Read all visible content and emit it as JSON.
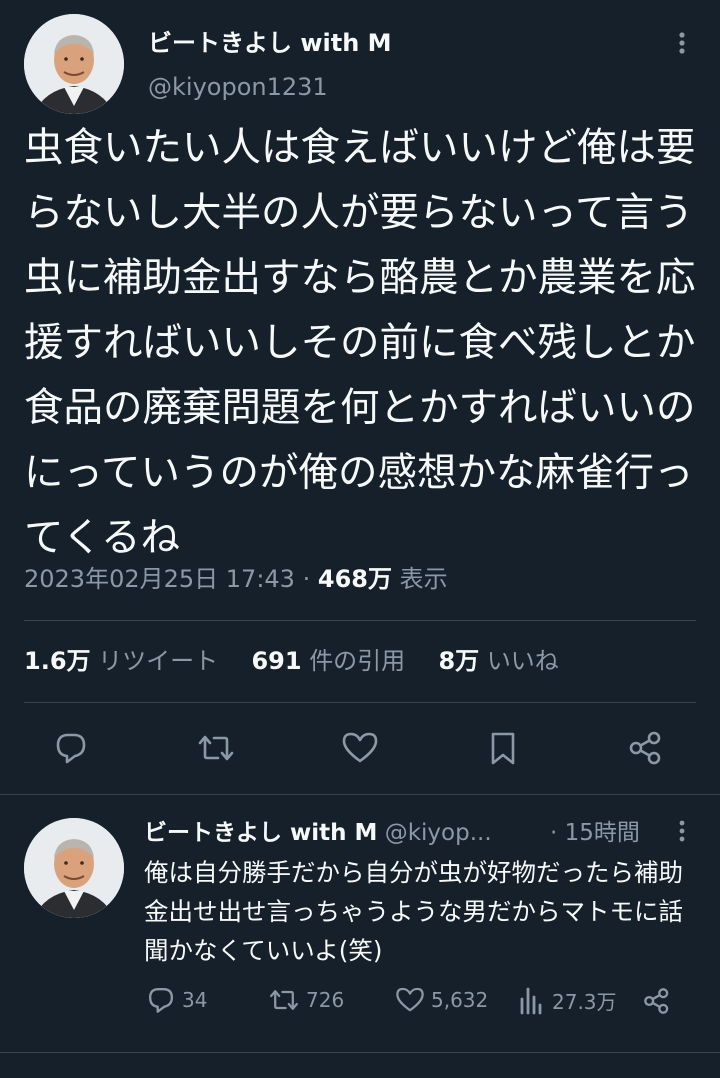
{
  "tweet": {
    "author_name": "ビートきよし with M",
    "author_handle": "@kiyopon1231",
    "text": "虫食いたい人は食えばいいけど俺は要らないし大半の人が要らないって言う虫に補助金出すなら酪農とか農業を応援すればいいしその前に食べ残しとか食品の廃棄問題を何とかすればいいのにっていうのが俺の感想かな麻雀行ってくるね",
    "timestamp": "2023年02月25日 17:43",
    "separator": "·",
    "views_count": "468万",
    "views_label": "表示",
    "retweets_count": "1.6万",
    "retweets_label": "リツイート",
    "quotes_count": "691",
    "quotes_label": "件の引用",
    "likes_count": "8万",
    "likes_label": "いいね"
  },
  "reply": {
    "author_name": "ビートきよし with M",
    "author_handle": "@kiyop...",
    "separator": "·",
    "time": "15時間",
    "text": "俺は自分勝手だから自分が虫が好物だったら補助金出せ出せ言っちゃうような男だからマトモに話聞かなくていいよ(笑)",
    "replies": "34",
    "retweets": "726",
    "likes": "5,632",
    "views": "27.3万"
  },
  "icons": {
    "more": "more-vertical-icon",
    "reply": "reply-icon",
    "retweet": "retweet-icon",
    "like": "like-icon",
    "bookmark": "bookmark-icon",
    "share": "share-icon",
    "views": "views-icon"
  },
  "colors": {
    "background": "#15202b",
    "text": "#f7f9f9",
    "muted": "#8b98a5",
    "divider": "#38444d"
  }
}
